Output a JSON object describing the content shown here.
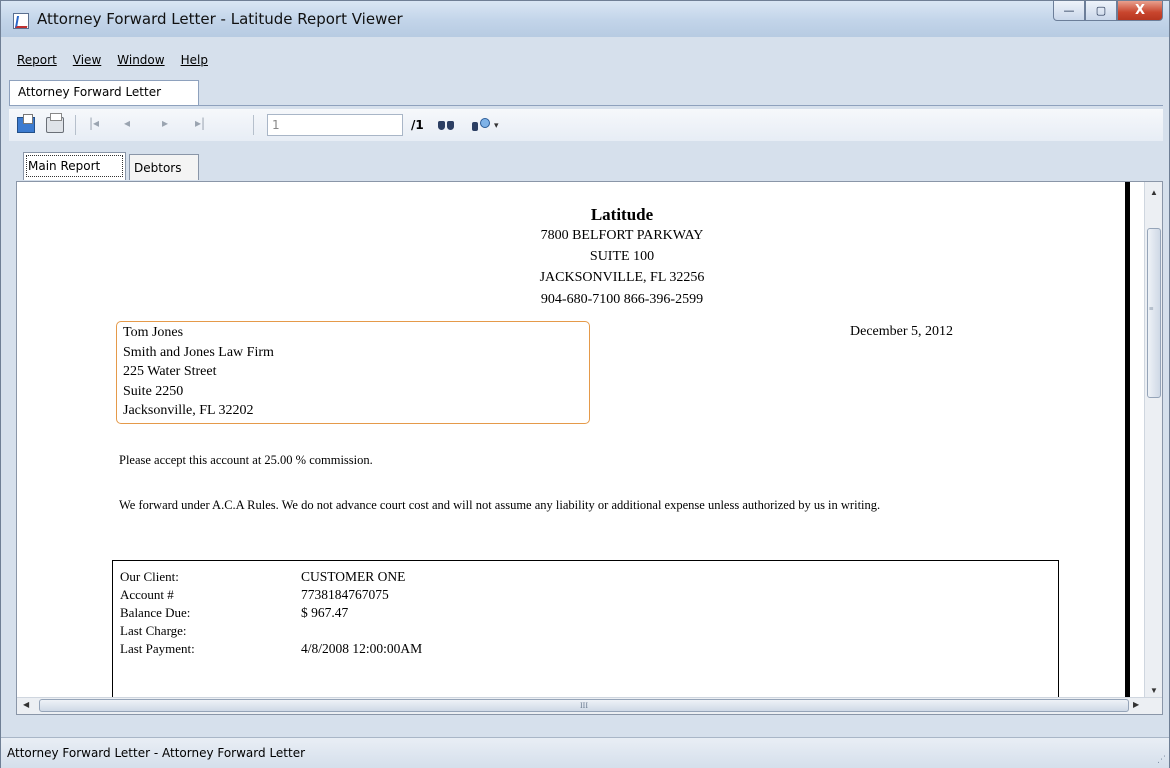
{
  "window": {
    "title": "Attorney Forward Letter - Latitude Report Viewer",
    "buttons": {
      "minimize": "—",
      "maximize": "▢",
      "close": "X"
    }
  },
  "menu": [
    "Report",
    "View",
    "Window",
    "Help"
  ],
  "doc_tab": "Attorney Forward Letter",
  "toolbar": {
    "nav_first": "|◂",
    "nav_prev": "◂",
    "nav_next": "▸",
    "nav_last": "▸|",
    "page_value": "1",
    "page_total": "/1",
    "dropdown_caret": "▾"
  },
  "report_tabs": [
    "Main Report",
    "Debtors"
  ],
  "report": {
    "company": "Latitude",
    "address1": "7800 BELFORT PARKWAY",
    "address2": "SUITE 100",
    "city": "JACKSONVILLE, FL  32256",
    "phones": "904-680-7100  866-396-2599",
    "recipient": [
      "Tom Jones",
      "Smith and Jones Law Firm",
      "225 Water Street",
      "Suite 2250",
      "Jacksonville, FL  32202"
    ],
    "date": "December 5, 2012",
    "para1": "Please accept this account at  25.00 % commission.",
    "para2": "We forward under A.C.A Rules.  We do not advance court cost and will not assume any liability or additional expense unless authorized by us in writing.",
    "account": {
      "labels": [
        "Our Client:",
        "Account #",
        "Balance Due:",
        "Last Charge:",
        "Last Payment:"
      ],
      "values": [
        "CUSTOMER ONE",
        "7738184767075",
        "$ 967.47",
        "",
        "4/8/2008 12:00:00AM"
      ]
    }
  },
  "scroll": {
    "h_grip": "III",
    "v_grip": "≡"
  },
  "status": "Attorney Forward Letter - Attorney Forward Letter",
  "colors": {
    "address_box_border": "#e59a4a",
    "close_button": "#c8452d"
  }
}
